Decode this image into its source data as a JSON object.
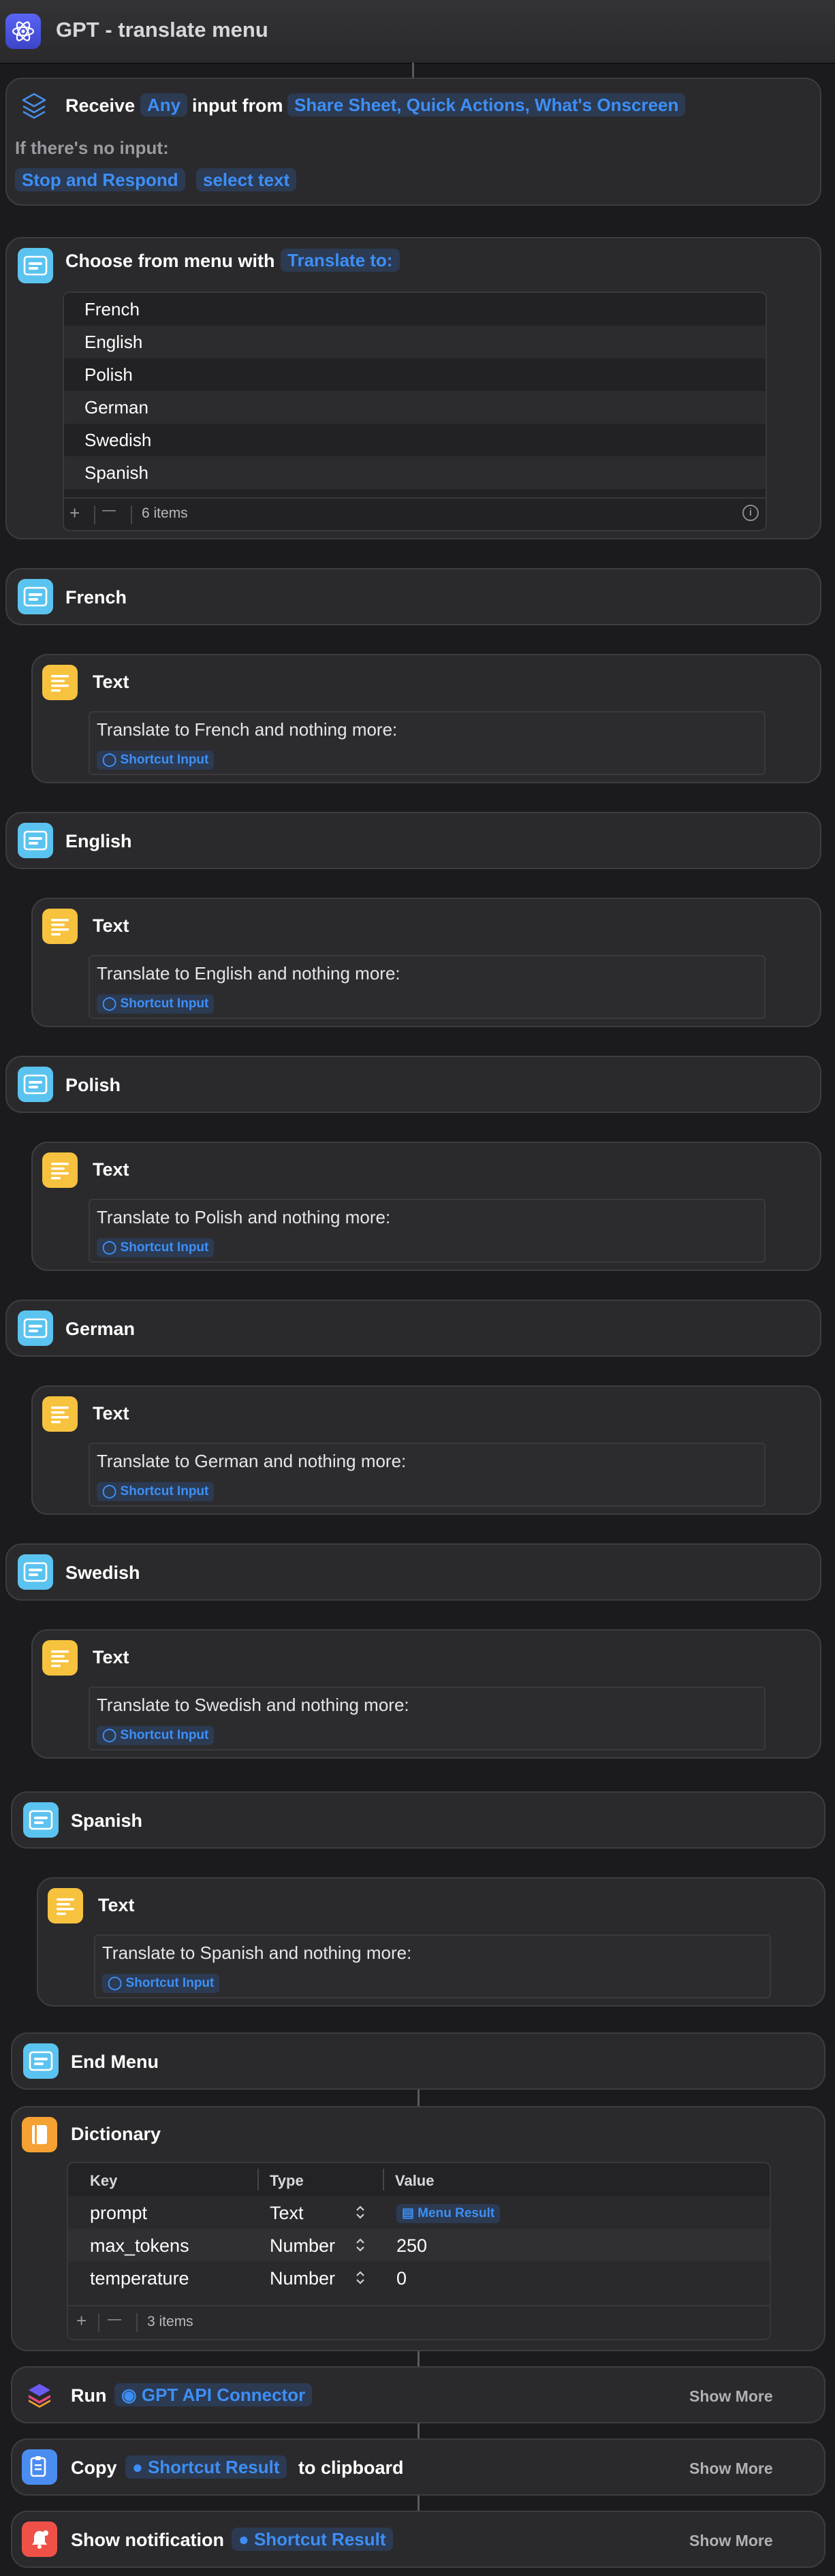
{
  "window": {
    "title": "GPT - translate menu"
  },
  "receive": {
    "label_receive": "Receive",
    "token_any": "Any",
    "label_input_from": "input from",
    "token_sources": "Share Sheet, Quick Actions, What's Onscreen",
    "no_input_label": "If there's no input:",
    "token_stop": "Stop and Respond",
    "token_select": "select text"
  },
  "choose_menu": {
    "label": "Choose from menu with",
    "token_prompt": "Translate to:",
    "items": [
      "French",
      "English",
      "Polish",
      "German",
      "Swedish",
      "Spanish"
    ],
    "add": "+",
    "remove": "—",
    "count": "6 items",
    "info": "i"
  },
  "cases": [
    {
      "title": "French",
      "text_label": "Text",
      "body": "Translate to French and nothing more:",
      "token": "Shortcut Input"
    },
    {
      "title": "English",
      "text_label": "Text",
      "body": "Translate to English and nothing more:",
      "token": "Shortcut Input"
    },
    {
      "title": "Polish",
      "text_label": "Text",
      "body": "Translate to Polish and nothing more:",
      "token": "Shortcut Input"
    },
    {
      "title": "German",
      "text_label": "Text",
      "body": "Translate to German and nothing more:",
      "token": "Shortcut Input"
    },
    {
      "title": "Swedish",
      "text_label": "Text",
      "body": "Translate to Swedish and nothing more:",
      "token": "Shortcut Input"
    },
    {
      "title": "Spanish",
      "text_label": "Text",
      "body": "Translate to Spanish and nothing more:",
      "token": "Shortcut Input"
    }
  ],
  "end_menu": {
    "label": "End Menu"
  },
  "dictionary": {
    "label": "Dictionary",
    "headers": {
      "key": "Key",
      "type": "Type",
      "value": "Value"
    },
    "rows": [
      {
        "key": "prompt",
        "type": "Text",
        "value": "Menu Result"
      },
      {
        "key": "max_tokens",
        "type": "Number",
        "value": "250"
      },
      {
        "key": "temperature",
        "type": "Number",
        "value": "0"
      }
    ],
    "add": "+",
    "remove": "—",
    "count": "3 items"
  },
  "run": {
    "label": "Run",
    "token": "GPT API Connector",
    "show_more": "Show More"
  },
  "copy": {
    "label": "Copy",
    "token": "Shortcut Result",
    "suffix": "to clipboard",
    "show_more": "Show More"
  },
  "notify": {
    "label": "Show notification",
    "token": "Shortcut Result",
    "show_more": "Show More"
  },
  "colors": {
    "background": "#1b1b1d",
    "card": "#2a2a2d",
    "accent_blue": "#3d8ff5",
    "menu_icon": "#5bc3ef",
    "text_icon": "#f7c23e",
    "dict_icon": "#f5a233",
    "copy_icon": "#4b8cf0",
    "notify_icon": "#ef5148"
  }
}
